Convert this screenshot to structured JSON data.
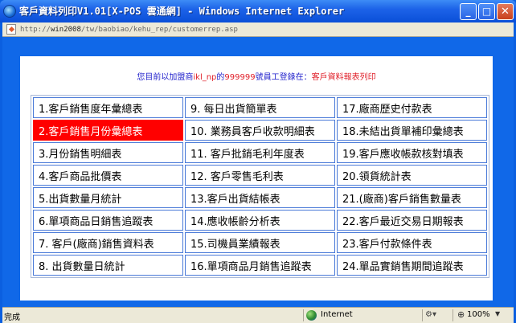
{
  "window": {
    "title": "客戶資料列印V1.01[X-POS 雲通網] - Windows Internet Explorer",
    "minimize_glyph": "_",
    "maximize_glyph": "□",
    "close_glyph": "✕"
  },
  "address": {
    "prefix": "http://",
    "host": "win2008",
    "path": "/tw/baobiao/kehu_rep/customerrep.asp"
  },
  "info": {
    "part1": "您目前以加盟商",
    "user": "ikl_np",
    "part2": "的",
    "employee_id": "999999",
    "part3": "號員工登錄在：",
    "location": "客戶資料報表列印"
  },
  "menu": {
    "rows": [
      [
        "1.客戶銷售度年彙總表",
        "9.  每日出貨簡單表",
        "17.廠商歷史付款表"
      ],
      [
        "2.客戶銷售月份彙總表",
        "10.  業務員客戶收款明細表",
        "18.未結出貨單補印彙總表"
      ],
      [
        "3.月份銷售明細表",
        "11.  客戶批銷毛利年度表",
        "19.客戶應收帳款核對填表"
      ],
      [
        "4.客戶商品批價表",
        "12.  客戶零售毛利表",
        "20.領貨統計表"
      ],
      [
        "5.出貨數量月統計",
        "13.客戶出貨結帳表",
        "21.(廠商)客戶銷售數量表"
      ],
      [
        "6.單項商品日銷售追蹤表",
        "14.應收帳齡分析表",
        "22.客戶最近交易日期報表"
      ],
      [
        "7.  客戶(廠商)銷售資料表",
        "15.司機員業績報表",
        "23.客戶付款條件表"
      ],
      [
        "8.  出貨數量日統計",
        "16.單項商品月銷售追蹤表",
        "24.單品實銷售期間追蹤表"
      ]
    ],
    "selected": "2.客戶銷售月份彙總表"
  },
  "status": {
    "text": "完成",
    "zone": "Internet",
    "zoom": "100%"
  }
}
